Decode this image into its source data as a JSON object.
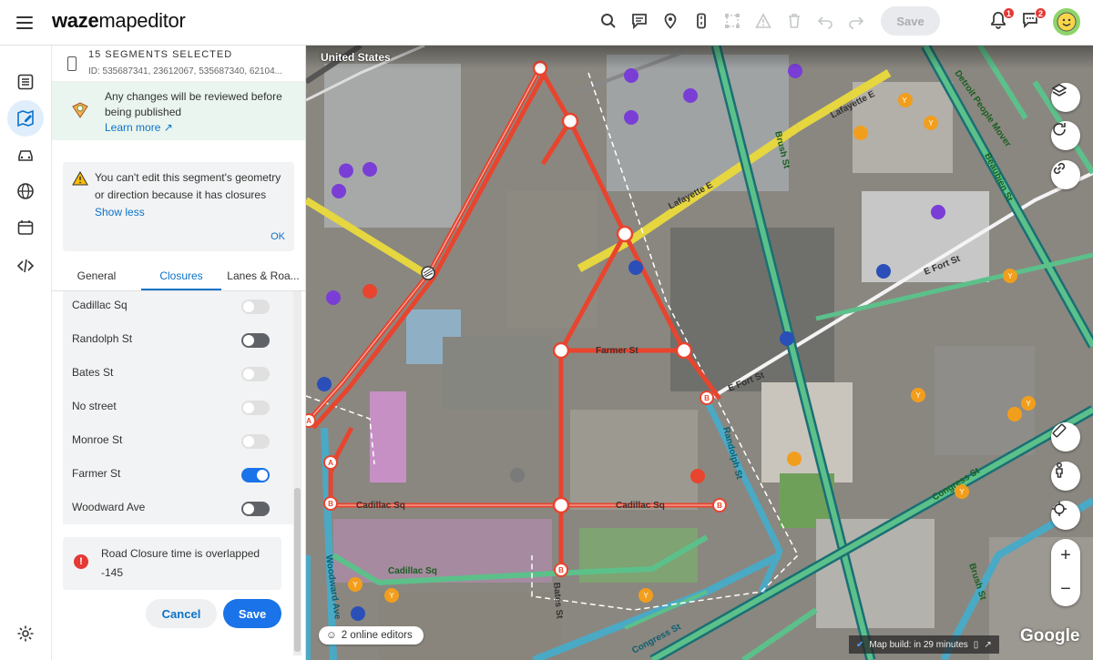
{
  "app": {
    "logo_main": "waze",
    "logo_rest": "mapeditor"
  },
  "topbar": {
    "save_label": "Save",
    "notifications_count": "1",
    "messages_count": "2",
    "icons": [
      "search-icon",
      "comment-icon",
      "place-icon",
      "segment-icon",
      "select-area-icon",
      "warning-icon",
      "trash-icon",
      "undo-icon",
      "redo-icon"
    ]
  },
  "rail": {
    "icons": [
      "list-icon",
      "edit-map-icon",
      "car-icon",
      "globe-icon",
      "calendar-icon",
      "code-icon",
      "settings-icon"
    ]
  },
  "panel": {
    "selection_title": "15 SEGMENTS SELECTED",
    "selection_ids": "ID: 535687341, 23612067, 535687340, 62104...",
    "review_text": "Any changes will be reviewed before being published",
    "learn_more": "Learn more",
    "warning_text": "You can't edit this segment's geometry or direction because it has closures",
    "show_less": "Show less",
    "ok": "OK",
    "tabs": [
      "General",
      "Closures",
      "Lanes & Roa..."
    ],
    "active_tab": "Closures",
    "streets": [
      {
        "name": "Cadillac Sq",
        "state": "off"
      },
      {
        "name": "Randolph St",
        "state": "dark"
      },
      {
        "name": "Bates St",
        "state": "off"
      },
      {
        "name": "No street",
        "state": "off"
      },
      {
        "name": "Monroe St",
        "state": "off"
      },
      {
        "name": "Farmer St",
        "state": "on"
      },
      {
        "name": "Woodward Ave",
        "state": "dark"
      }
    ],
    "error_text": "Road Closure time is overlapped",
    "error_value": "-145",
    "cancel": "Cancel",
    "save": "Save"
  },
  "map": {
    "region": "United States",
    "online_editors": "2 online editors",
    "map_build": "Map build: in 29 minutes",
    "attribution": "Google",
    "street_labels": [
      "Lafayette E",
      "Lafayette E",
      "Detroit People Mover",
      "Beaubien St",
      "Brush St",
      "E Fort St",
      "E Fort St",
      "Farmer St",
      "Randolph St",
      "Cadillac Sq",
      "Cadillac Sq",
      "Cadillac Sq",
      "Woodward Ave",
      "Bates St",
      "Congress St",
      "Brush St",
      "Congress St"
    ],
    "node_labels": [
      "A",
      "A",
      "B",
      "B",
      "B",
      "B",
      "B"
    ]
  }
}
